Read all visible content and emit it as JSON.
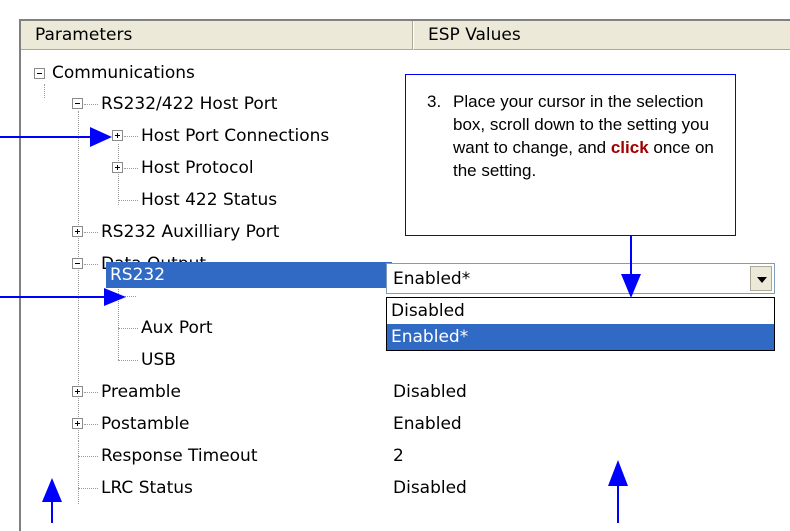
{
  "columns": {
    "parameters": "Parameters",
    "values": "ESP Values"
  },
  "tree": [
    {
      "id": "communications",
      "label": "Communications",
      "expander": "minus"
    },
    {
      "id": "rs232-422",
      "label": "RS232/422 Host Port",
      "expander": "minus"
    },
    {
      "id": "host-port-connections",
      "label": "Host Port Connections",
      "expander": "plus"
    },
    {
      "id": "host-protocol",
      "label": "Host Protocol",
      "expander": "plus"
    },
    {
      "id": "host-422-status",
      "label": "Host 422 Status"
    },
    {
      "id": "rs232-aux",
      "label": "RS232 Auxilliary Port",
      "expander": "plus"
    },
    {
      "id": "data-output",
      "label": "Data Output",
      "expander": "minus"
    },
    {
      "id": "rs232",
      "label": "RS232"
    },
    {
      "id": "aux-port",
      "label": "Aux Port"
    },
    {
      "id": "usb",
      "label": "USB"
    },
    {
      "id": "preamble",
      "label": "Preamble",
      "expander": "plus",
      "value": "Disabled"
    },
    {
      "id": "postamble",
      "label": "Postamble",
      "expander": "plus",
      "value": "Enabled"
    },
    {
      "id": "response-timeout",
      "label": "Response Timeout",
      "value": "2"
    },
    {
      "id": "lrc-status",
      "label": "LRC Status",
      "value": "Disabled"
    }
  ],
  "combo": {
    "value": "Enabled*",
    "options": [
      "Disabled",
      "Enabled*"
    ],
    "highlighted": "Enabled*"
  },
  "callout": {
    "number": "3.",
    "text_before": "Place your cursor in the selection box, scroll down to the setting you want to change, and ",
    "emphasis": "click",
    "text_after": " once on the setting."
  },
  "colors": {
    "selection": "#316ac5",
    "callout_border": "#0000ff",
    "arrow": "#0000ff",
    "emphasis": "#a00000",
    "header": "#ece9d8"
  },
  "icons": {
    "expand": "plus-box-icon",
    "collapse": "minus-box-icon",
    "dropdown": "triangle-down-icon",
    "pointer": "arrow-icon"
  }
}
